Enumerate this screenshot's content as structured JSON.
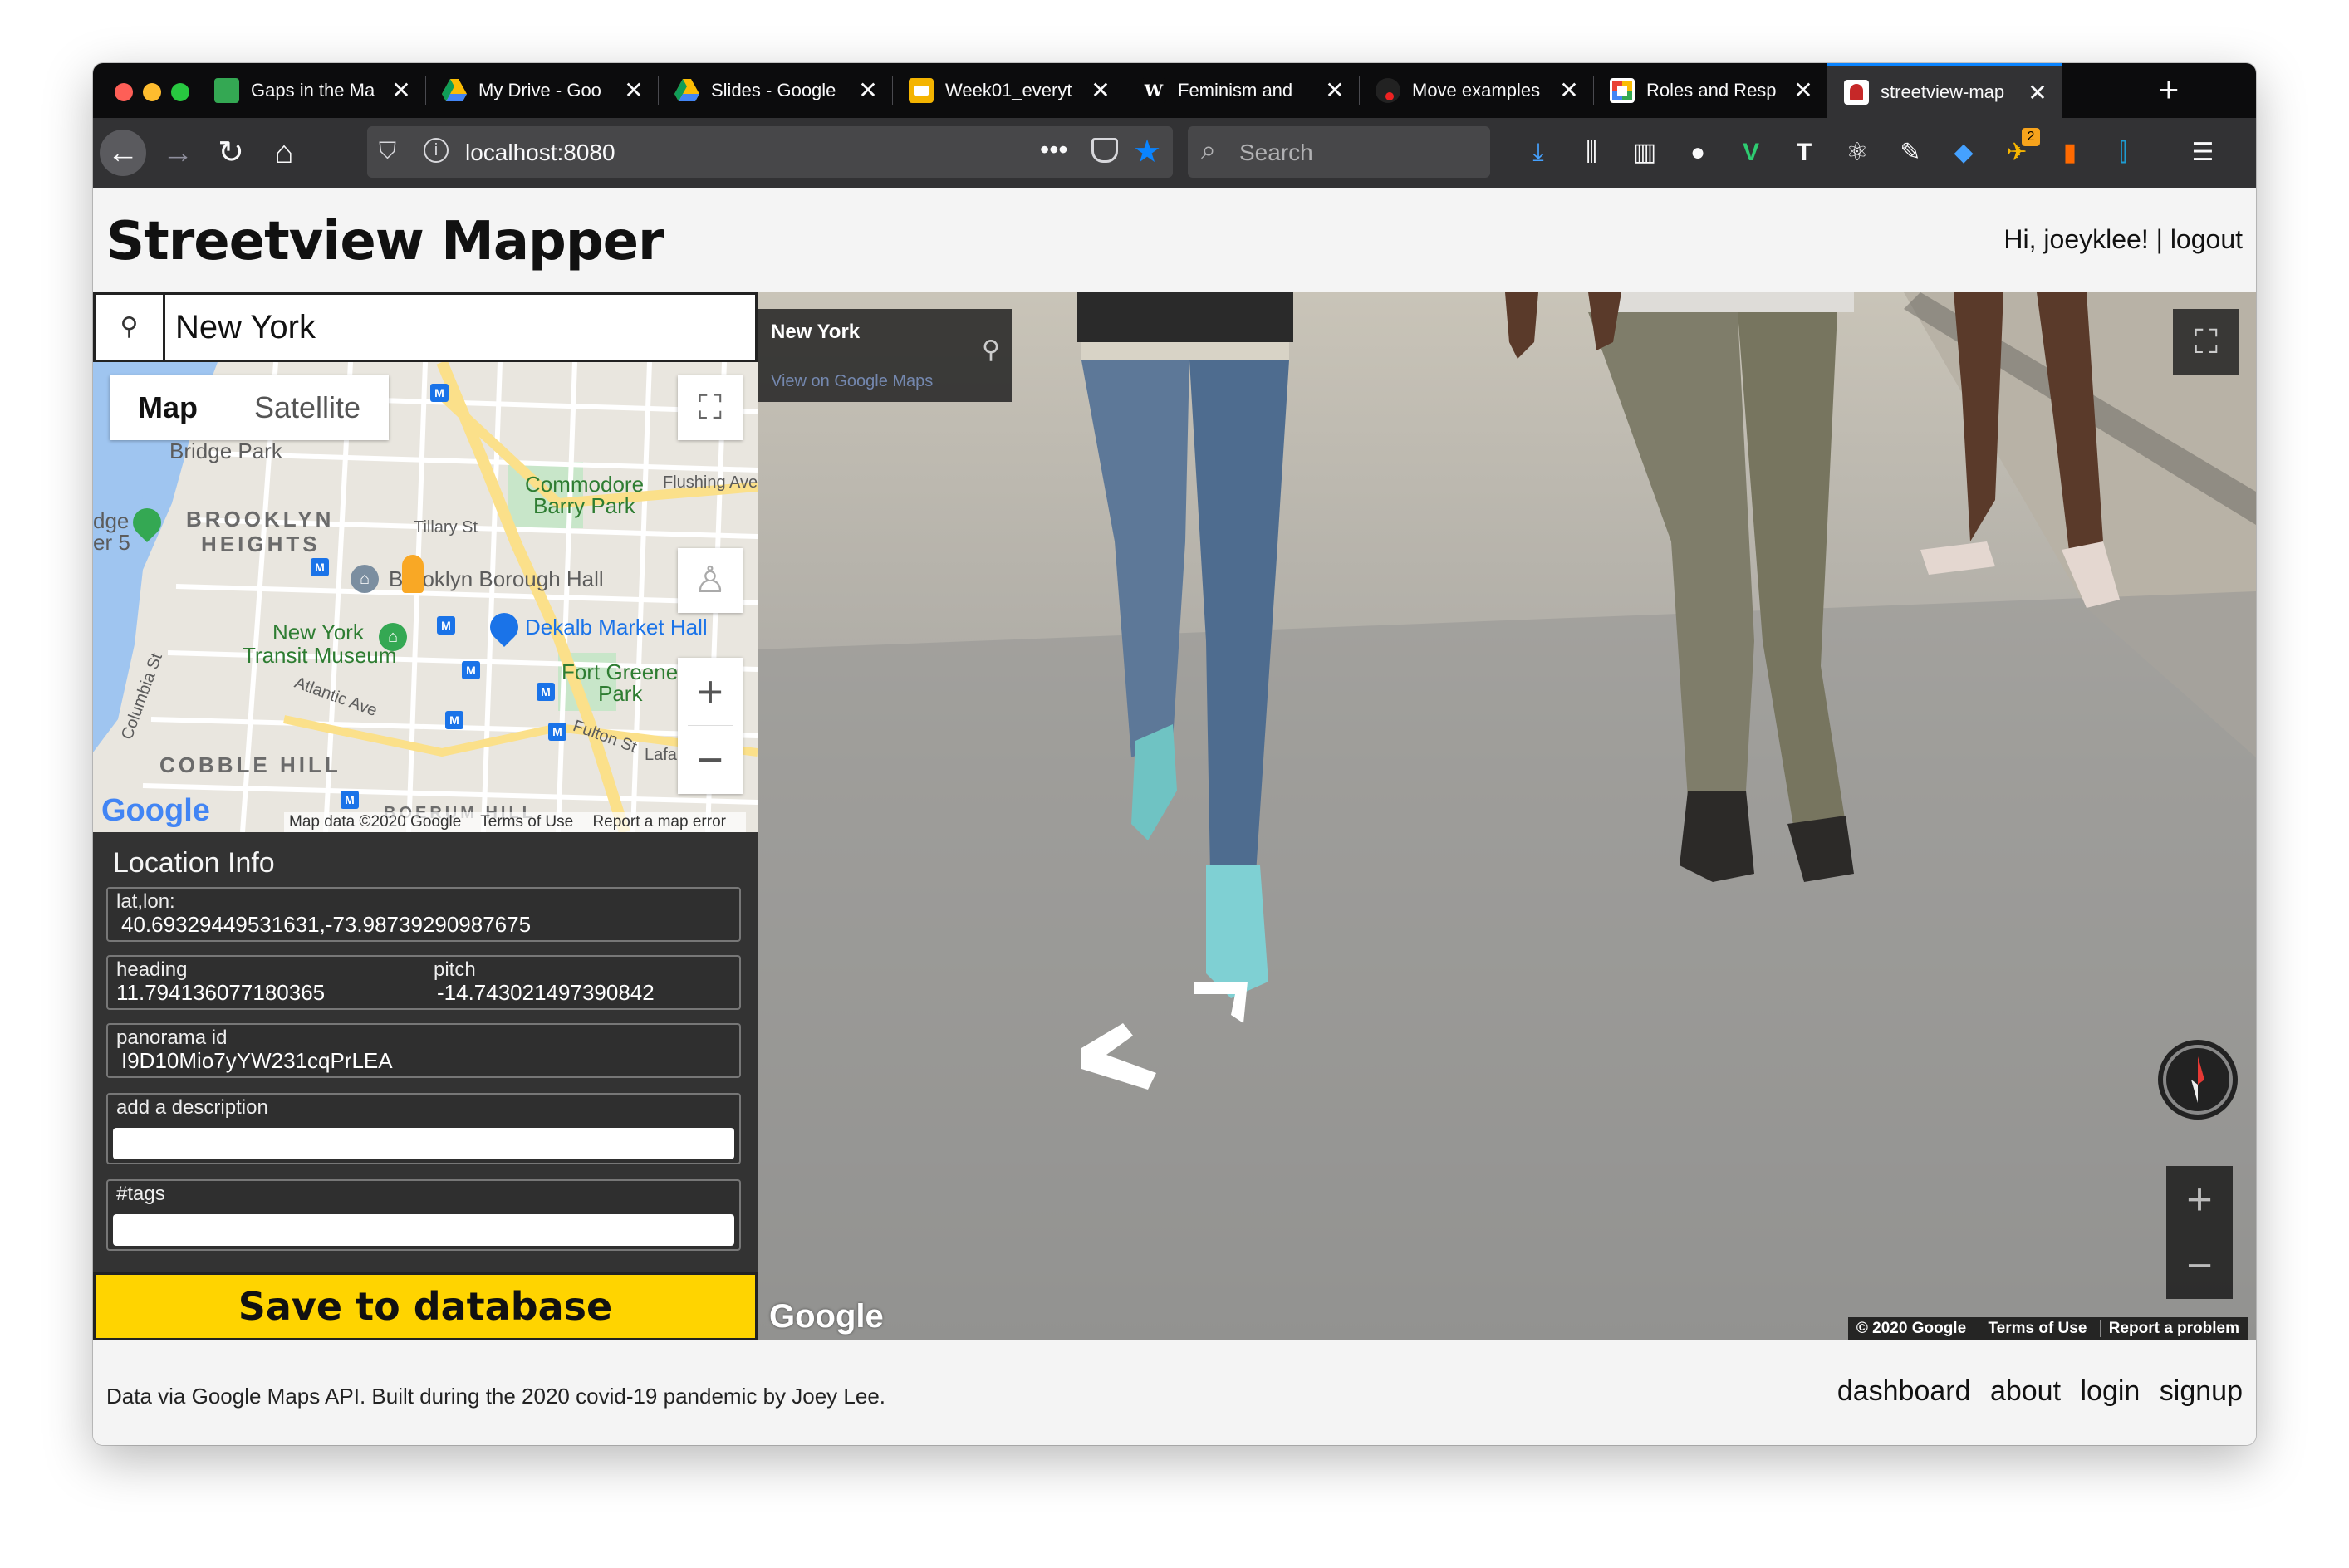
{
  "browser": {
    "tabs": [
      {
        "label": "Gaps in the Ma",
        "favicon_color": "#34a853"
      },
      {
        "label": "My Drive - Goo",
        "favicon_color": "#fbbc04"
      },
      {
        "label": "Slides - Google",
        "favicon_color": "#fbbc04"
      },
      {
        "label": "Week01_everyt",
        "favicon_color": "#f4b400"
      },
      {
        "label": "Feminism and",
        "favicon_color": "#0c0c0d",
        "favicon_glyph": "W"
      },
      {
        "label": "Move examples",
        "favicon_color": "#222222"
      },
      {
        "label": "Roles and Resp",
        "favicon_color": "#ffffff"
      },
      {
        "label": "streetview-map",
        "favicon_color": "#ffffff",
        "active": true
      }
    ],
    "url": "localhost:8080",
    "search_placeholder": "Search",
    "toolbar_badge": "2"
  },
  "header": {
    "title": "Streetview Mapper",
    "greeting": "Hi, joeyklee!",
    "separator": "|",
    "logout": "logout"
  },
  "search": {
    "value": "New York"
  },
  "map": {
    "type_map": "Map",
    "type_satellite": "Satellite",
    "labels": {
      "bridge_park": "Bridge Park",
      "commodore": "Commodore",
      "barry_park": "Barry Park",
      "flushing": "Flushing Ave",
      "brooklyn": "BROOKLYN",
      "heights": "HEIGHTS",
      "dge": "dge",
      "er5": "er 5",
      "tillary": "Tillary St",
      "borough_hall": "Brooklyn Borough Hall",
      "dekalb": "Dekalb Market Hall",
      "new_york": "New York",
      "transit_museum": "Transit Museum",
      "fort_greene": "Fort Greene",
      "park": "Park",
      "atlantic": "Atlantic Ave",
      "fulton": "Fulton St",
      "lafa": "Lafa",
      "columbia": "Columbia St",
      "cobble_hill": "COBBLE HILL",
      "boerum_hill": "BOERUM HILL"
    },
    "google": "Google",
    "attribution": {
      "data": "Map data ©2020 Google",
      "terms": "Terms of Use",
      "report": "Report a map error"
    }
  },
  "location_info": {
    "title": "Location Info",
    "latlon_label": "lat,lon:",
    "latlon_value": "40.69329449531631,-73.98739290987675",
    "heading_label": "heading",
    "heading_value": "11.794136077180365",
    "pitch_label": "pitch",
    "pitch_value": "-14.743021497390842",
    "pano_label": "panorama id",
    "pano_value": "I9D10Mio7yYW231cqPrLEA",
    "description_label": "add a description",
    "description_value": "",
    "tags_label": "#tags",
    "tags_value": "",
    "save_label": "Save to database"
  },
  "streetview": {
    "place": "New York",
    "view_link": "View on Google Maps",
    "google": "Google",
    "attribution": {
      "copyright": "© 2020 Google",
      "terms": "Terms of Use",
      "report": "Report a problem"
    }
  },
  "footer": {
    "text": "Data via Google Maps API. Built during the 2020 covid-19 pandemic by Joey Lee.",
    "links": [
      "dashboard",
      "about",
      "login",
      "signup"
    ]
  },
  "colors": {
    "accent_yellow": "#ffd400",
    "panel_dark": "#333333",
    "firefox_blue": "#0a84ff"
  }
}
